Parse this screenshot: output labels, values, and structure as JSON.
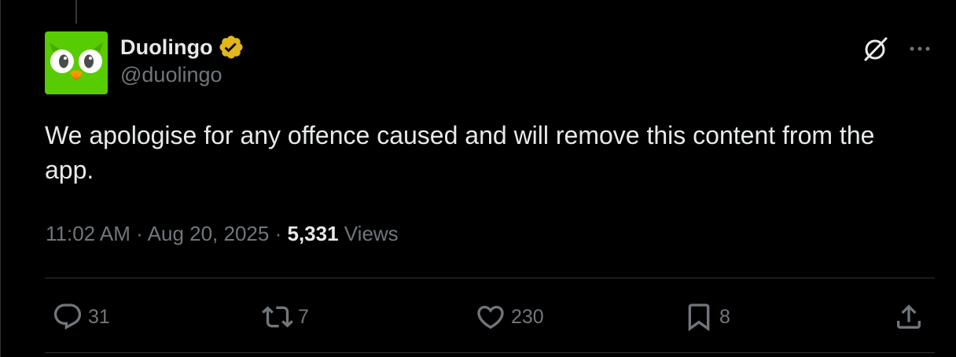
{
  "author": {
    "display_name": "Duolingo",
    "handle": "@duolingo",
    "verified": true,
    "avatar_icon": "duolingo-owl-logo",
    "avatar_color": "#58cc02"
  },
  "post": {
    "text": "We apologise for any offence caused and will remove this content from the app.",
    "time": "11:02 AM",
    "separator": "·",
    "date": "Aug 20, 2025",
    "views_count": "5,331",
    "views_label": "Views"
  },
  "actions": {
    "reply": {
      "icon": "reply-icon",
      "count": "31"
    },
    "retweet": {
      "icon": "retweet-icon",
      "count": "7"
    },
    "like": {
      "icon": "heart-icon",
      "count": "230"
    },
    "bookmark": {
      "icon": "bookmark-icon",
      "count": "8"
    },
    "share": {
      "icon": "share-icon"
    }
  },
  "top_icons": [
    "grok-icon",
    "more-icon"
  ],
  "colors": {
    "background": "#000000",
    "text": "#e7e9ea",
    "secondary": "#71767b",
    "verified_badge": "#e2b719",
    "divider": "#2f3336"
  }
}
